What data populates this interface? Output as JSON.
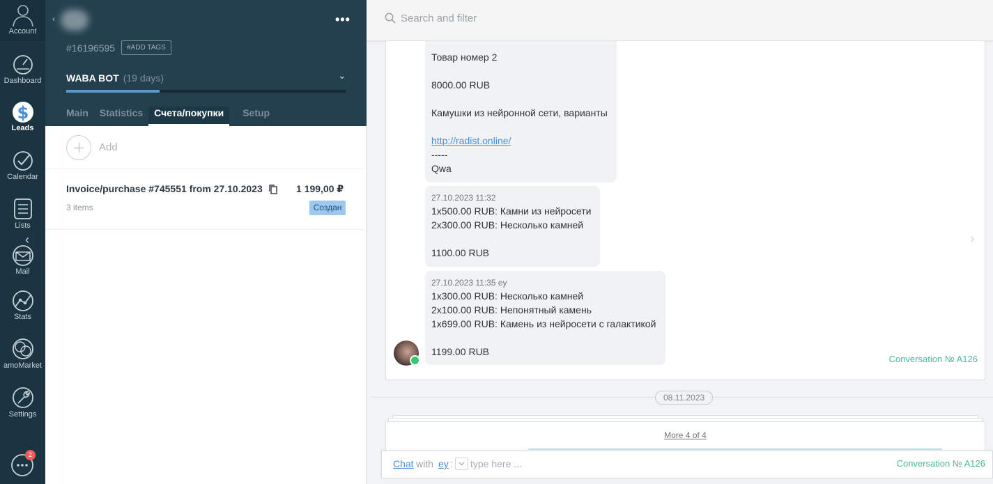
{
  "nav": {
    "items": [
      {
        "label": "Account",
        "icon": "account-icon"
      },
      {
        "label": "Dashboard",
        "icon": "dashboard-icon"
      },
      {
        "label": "Leads",
        "icon": "leads-dollar-icon"
      },
      {
        "label": "Calendar",
        "icon": "calendar-check-icon"
      },
      {
        "label": "Lists",
        "icon": "lists-icon"
      },
      {
        "label": "Mail",
        "icon": "mail-icon"
      },
      {
        "label": "Stats",
        "icon": "stats-icon"
      },
      {
        "label": "amoMarket",
        "icon": "amomarket-icon"
      },
      {
        "label": "Settings",
        "icon": "settings-icon"
      }
    ],
    "active": "Leads",
    "chat_badge": "2"
  },
  "lead": {
    "id": "#16196595",
    "add_tags": "#ADD TAGS",
    "pipeline": "WABA BOT",
    "days": "(19 days)",
    "progress": 0.335,
    "tabs": [
      "Main",
      "Statistics",
      "Счета/покупки",
      "Setup"
    ],
    "active_tab": "Счета/покупки",
    "add_label": "Add",
    "invoice": {
      "title": "Invoice/purchase #745551 from 27.10.2023",
      "sum": "1 199,00 ₽",
      "items": "3 items",
      "status": "Создан"
    }
  },
  "feed": {
    "search_placeholder": "Search and filter",
    "messages": [
      {
        "lines": [
          "Товар номер 2",
          "",
          "8000.00 RUB",
          "",
          "Камушки из нейронной сети, варианты",
          ""
        ],
        "link": "http://radist.online/",
        "tail": [
          "-----",
          "Qwa"
        ]
      },
      {
        "meta": "27.10.2023 11:32",
        "lines": [
          "1x500.00 RUB: Камни из нейросети",
          "2x300.00 RUB: Несколько камней",
          "",
          "1100.00 RUB"
        ]
      },
      {
        "meta": "27.10.2023 11:35 ey",
        "lines": [
          "1x300.00 RUB: Несколько камней",
          "2x100.00 RUB: Непонятный камень",
          "1x699.00 RUB: Камень из нейросети с галактикой",
          "",
          "1199.00 RUB"
        ]
      }
    ],
    "conversation_no": "Conversation № A126",
    "date_separator": "08.11.2023",
    "more": "More 4 of 4",
    "composer": {
      "chat": "Chat",
      "with": "with",
      "user": "ey",
      "colon": ":",
      "placeholder": "type here ...",
      "conversation_no": "Conversation № A126"
    }
  },
  "colors": {
    "nav_bg": "#1b3441",
    "header_bg": "#24404f",
    "accent_blue": "#4a8ed6",
    "conv_green": "#4fb79a",
    "status_badge": "#9dc8f0",
    "notification_red": "#f25a5a"
  }
}
